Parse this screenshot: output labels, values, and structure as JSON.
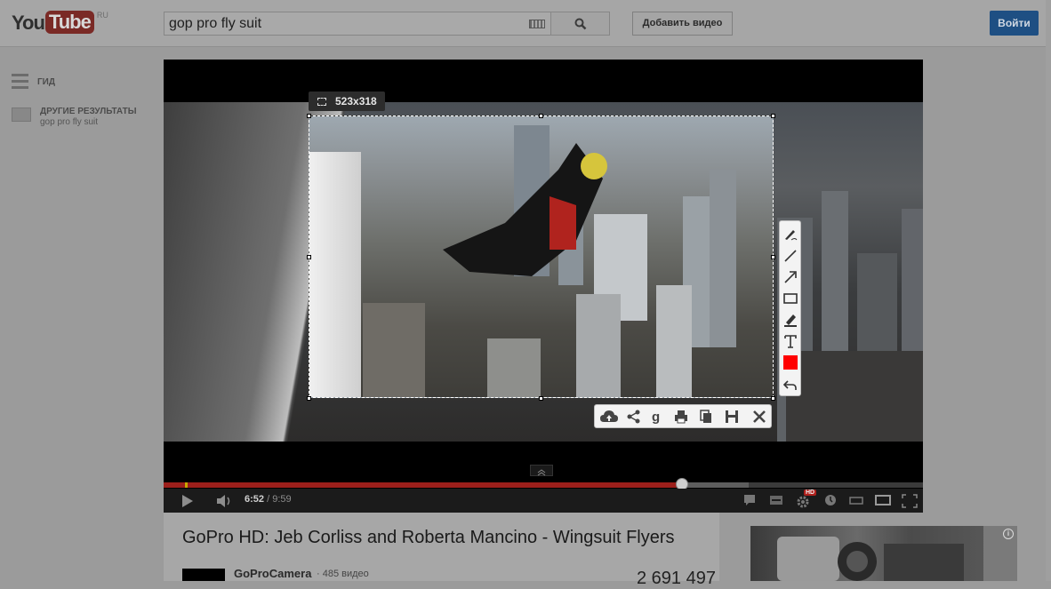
{
  "header": {
    "logo_you": "You",
    "logo_tube": "Tube",
    "logo_region": "RU",
    "search_value": "gop pro fly suit",
    "add_video_label": "Добавить видео",
    "signin_label": "Войти",
    "signin_color": "#1e4f83"
  },
  "sidebar": {
    "guide_label": "ГИД",
    "other_results_label": "ДРУГИЕ РЕЗУЛЬТАТЫ",
    "other_results_sub": "gop pro fly suit"
  },
  "capture": {
    "size_label": "523x318",
    "side_tools": [
      "pen-icon",
      "line-icon",
      "arrow-icon",
      "rectangle-icon",
      "marker-icon",
      "text-icon",
      "color-swatch",
      "undo-icon"
    ],
    "bottom_tools": [
      "cloud-upload-icon",
      "share-icon",
      "google-search-icon",
      "print-icon",
      "copy-icon",
      "save-icon",
      "close-icon"
    ],
    "accent_color": "#ff0000"
  },
  "player": {
    "current_time": "6:52",
    "duration": " / 9:59",
    "progress_fraction": 0.683,
    "buffered_fraction": 0.77,
    "hd_badge": "HD",
    "progress_color": "#9c1f1b"
  },
  "video": {
    "title": "GoPro HD: Jeb Corliss and Roberta Mancino - Wingsuit Flyers",
    "channel": "GoProCamera",
    "video_count": "· 485 видео",
    "views": "2 691 497"
  }
}
